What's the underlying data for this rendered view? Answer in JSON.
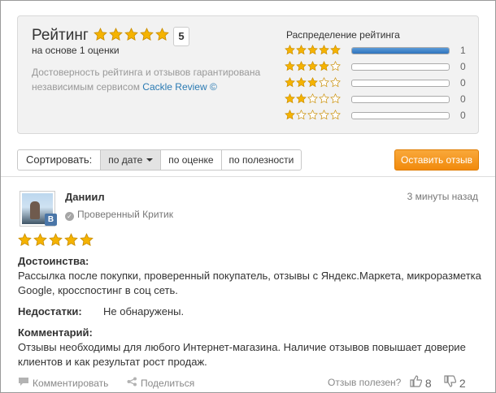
{
  "summary": {
    "title": "Рейтинг",
    "score": "5",
    "score_stars": 5,
    "based_on": "на основе 1 оценки",
    "guarantee_text": "Достоверность рейтинга и отзывов гарантирована независимым сервисом",
    "guarantee_link": "Cackle Review ©",
    "distribution_title": "Распределение рейтинга",
    "distribution": [
      {
        "stars": 5,
        "count": "1",
        "fraction": 1.0
      },
      {
        "stars": 4,
        "count": "0",
        "fraction": 0
      },
      {
        "stars": 3,
        "count": "0",
        "fraction": 0
      },
      {
        "stars": 2,
        "count": "0",
        "fraction": 0
      },
      {
        "stars": 1,
        "count": "0",
        "fraction": 0
      }
    ]
  },
  "toolbar": {
    "sort_label": "Сортировать:",
    "sort_options": [
      "по дате",
      "по оценке",
      "по полезности"
    ],
    "active_sort": "по дате",
    "write_button": "Оставить отзыв"
  },
  "review": {
    "author": "Даниил",
    "badge": "В",
    "verified": "Проверенный Критик",
    "time": "3 минуты назад",
    "stars": 5,
    "pros_label": "Достоинства:",
    "pros_text": "Рассылка после покупки, проверенный покупатель, отзывы с Яндекс.Маркета, микроразметка Google, кросспостинг в соц сеть.",
    "cons_label": "Недостатки:",
    "cons_text": "Не обнаружены.",
    "comment_label": "Комментарий:",
    "comment_text": "Отзывы необходимы для любого Интернет-магазина. Наличие отзывов повышает доверие клиентов и как результат рост продаж.",
    "comment_action": "Комментировать",
    "share_action": "Поделиться",
    "helpful_question": "Отзыв полезен?",
    "likes": "8",
    "dislikes": "2"
  },
  "colors": {
    "star_fill": "#f5b301",
    "button_orange": "#f39c1f",
    "bar_blue": "#2f73bd",
    "link_blue": "#2a7ab3"
  }
}
